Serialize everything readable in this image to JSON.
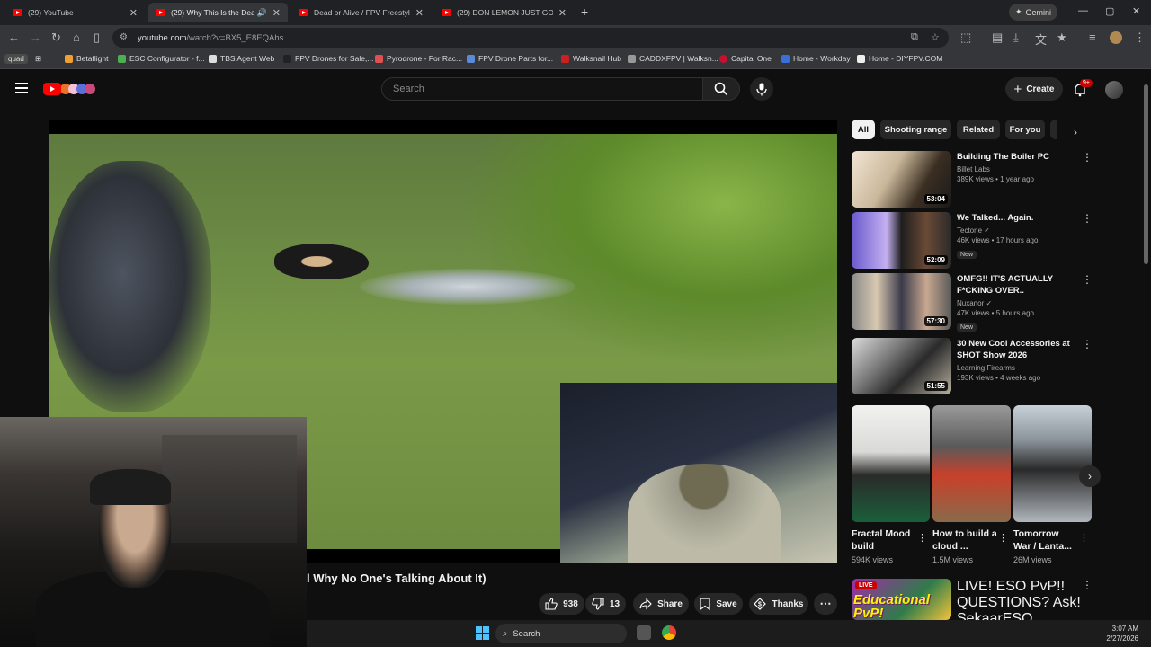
{
  "browser": {
    "tabs": [
      {
        "title": "(29) YouTube",
        "active": false
      },
      {
        "title": "(29) Why This Is the Deadlie",
        "active": true
      },
      {
        "title": "Dead or Alive / FPV Freestyle -",
        "active": false
      },
      {
        "title": "(29) DON LEMON JUST GOT M",
        "active": false
      }
    ],
    "new_tab": "+",
    "gemini_label": "Gemini",
    "url_host": "youtube.com",
    "url_path": "/watch?v=BX5_E8EQAhs",
    "bookmarks_folder": "quad",
    "bookmarks": [
      "Betaflight",
      "ESC Configurator - f...",
      "TBS Agent Web",
      "FPV Drones for Sale,...",
      "Pyrodrone - For Rac...",
      "FPV Drone Parts for...",
      "Walksnail Hub",
      "CADDXFPV | Walksn...",
      "Capital One",
      "Home - Workday",
      "Home - DIYFPV.COM"
    ]
  },
  "youtube": {
    "search_placeholder": "Search",
    "create_label": "Create",
    "notif_badge": "9+",
    "video_title": "l Why No One's Talking About It)",
    "likes": "938",
    "dislikes": "13",
    "share_label": "Share",
    "save_label": "Save",
    "thanks_label": "Thanks",
    "more_label": "⋯",
    "chips": [
      "All",
      "Shooting range",
      "Related",
      "For you"
    ],
    "recommendations": [
      {
        "title": "Building The Boiler PC",
        "channel": "Billet Labs",
        "meta": "389K views • 1 year ago",
        "duration": "53:04",
        "new": ""
      },
      {
        "title": "We Talked... Again.",
        "channel": "Tectone",
        "meta": "46K views • 17 hours ago",
        "duration": "52:09",
        "new": "New"
      },
      {
        "title": "OMFG!! IT'S ACTUALLY F*CKING OVER..",
        "channel": "Nuxanor",
        "meta": "47K views • 5 hours ago",
        "duration": "57:30",
        "new": "New"
      },
      {
        "title": "30 New Cool Accessories at SHOT Show 2026",
        "channel": "Learning Firearms",
        "meta": "193K views • 4 weeks ago",
        "duration": "51:55",
        "new": ""
      }
    ],
    "shorts": [
      {
        "title": "Fractal Mood build",
        "views": "594K views"
      },
      {
        "title": "How to build a cloud ...",
        "views": "1.5M views"
      },
      {
        "title": "Tomorrow War / Lanta...",
        "views": "26M views"
      }
    ],
    "live": {
      "badge": "LIVE",
      "thumb_text": "Educational PvP!",
      "title": "LIVE! ESO PvP!! QUESTIONS? Ask!",
      "channel": "SekaarESO"
    }
  },
  "taskbar": {
    "search_label": "Search",
    "time": "3:07 AM",
    "date": "2/27/2026"
  },
  "icons": {
    "search": "search-icon",
    "mic": "mic-icon",
    "bell": "bell-icon",
    "menu": "hamburger-icon",
    "like": "thumbs-up-icon",
    "dislike": "thumbs-down-icon",
    "share": "share-icon",
    "save": "bookmark-icon",
    "thanks": "thanks-icon"
  },
  "colors": {
    "accent": "#ff0000",
    "bg": "#0f0f0f",
    "chip_bg": "#272727",
    "live_red": "#cc0000"
  }
}
